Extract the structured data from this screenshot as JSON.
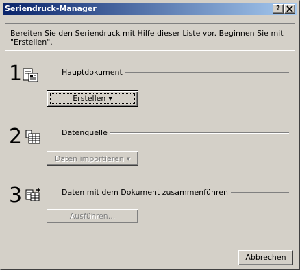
{
  "window": {
    "title": "Seriendruck-Manager",
    "help_button": "?",
    "close_button": "X"
  },
  "info": {
    "text_line1": "Bereiten Sie den Seriendruck mit Hilfe dieser Liste vor. Beginnen Sie mit",
    "text_line2": "\"Erstellen\"."
  },
  "steps": [
    {
      "number": "1",
      "label": "Hauptdokument",
      "icon": "main-document-icon",
      "button": {
        "label": "Erstellen",
        "has_dropdown": true,
        "enabled": true
      }
    },
    {
      "number": "2",
      "label": "Datenquelle",
      "icon": "data-source-icon",
      "button": {
        "label": "Daten importieren",
        "has_dropdown": true,
        "enabled": false
      }
    },
    {
      "number": "3",
      "label": "Daten mit dem Dokument zusammenführen",
      "icon": "merge-icon",
      "button": {
        "label": "Ausführen...",
        "has_dropdown": false,
        "enabled": false
      }
    }
  ],
  "footer": {
    "cancel_label": "Abbrechen"
  }
}
